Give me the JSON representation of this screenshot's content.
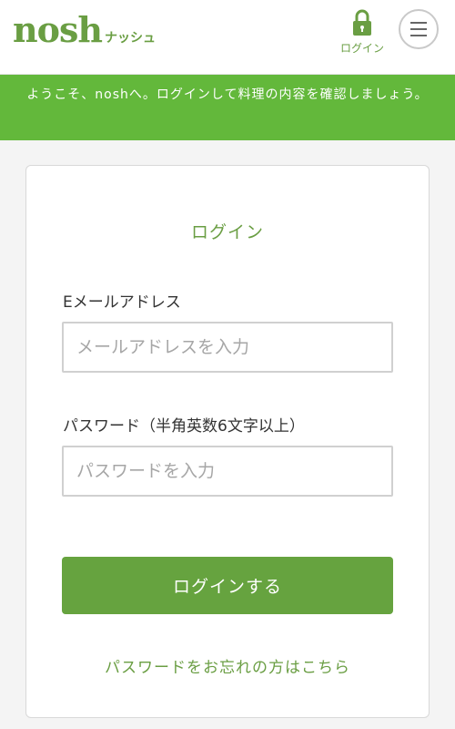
{
  "header": {
    "logo_main": "nosh",
    "logo_sub": "ナッシュ",
    "login_link_label": "ログイン",
    "login_icon": "lock-icon",
    "menu_icon": "hamburger-menu-icon"
  },
  "banner": {
    "message": "ようこそ、noshへ。ログインして料理の内容を確認しましょう。"
  },
  "login_form": {
    "title": "ログイン",
    "email": {
      "label": "Eメールアドレス",
      "placeholder": "メールアドレスを入力",
      "value": ""
    },
    "password": {
      "label": "パスワード（半角英数6文字以上）",
      "placeholder": "パスワードを入力",
      "value": ""
    },
    "submit_label": "ログインする",
    "forgot_password_label": "パスワードをお忘れの方はこちら"
  },
  "colors": {
    "brand_green": "#6a9e43",
    "banner_green": "#63b83b",
    "button_green": "#66a33f"
  }
}
